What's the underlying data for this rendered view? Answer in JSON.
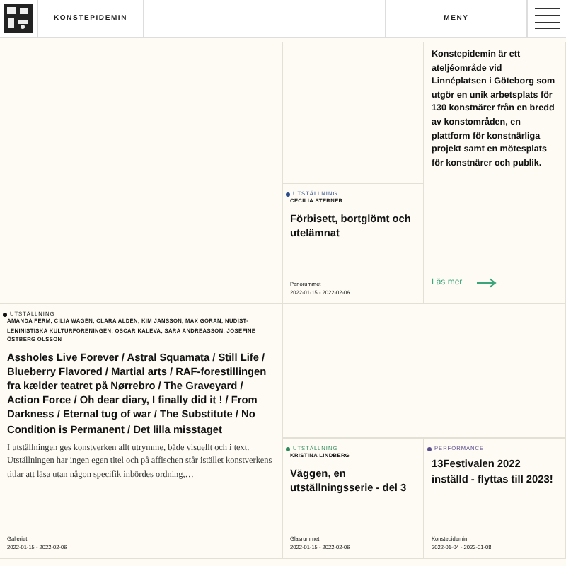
{
  "header": {
    "site_name": "KONSTEPIDEMIN",
    "menu_label": "MENY"
  },
  "intro": {
    "text": "Konstepidemin är ett ateljéområde vid Linnéplatsen i Göteborg som utgör en unik arbetsplats för 130 konstnärer från en bredd av konstområden, en plattform för konstnärliga projekt samt en mötesplats för konstnärer och publik.",
    "link": "Läs mer"
  },
  "events": [
    {
      "category": "UTSTÄLLNING",
      "color": "#2b4c8c",
      "artists": "CECILIA STERNER",
      "title": "Förbisett, bortglömt och utelämnat",
      "venue": "Panorummet",
      "dates": "2022-01-15 - 2022-02-06"
    },
    {
      "category": "UTSTÄLLNING",
      "color": "#111111",
      "artists": "AMANDA FERM, CILIA WAGÉN, CLARA ALDÉN, KIM JANSSON, MAX GÖRAN, NUDIST-LENINISTISKA KULTURFÖRENINGEN, OSCAR KALEVA, SARA ANDREASSON, JOSEFINE ÖSTBERG OLSSON",
      "title": "Assholes Live Forever / Astral Squamata / Still Life / Blueberry Flavored / Martial arts / RAF-forestillingen fra kælder teatret på Nørrebro / The Graveyard / Action Force / Oh dear diary, I finally did it ! / From Darkness / Eternal tug of war / The Substitute / No Condition is Permanent / Det lilla misstaget",
      "excerpt": "I utställningen ges konstverken allt utrymme, både visuellt och i text. Utställningen har ingen egen titel och på affischen står istället konstverkens titlar att läsa utan någon specifik inbördes ordning,…",
      "venue": "Galleriet",
      "dates": "2022-01-15 - 2022-02-06"
    },
    {
      "category": "UTSTÄLLNING",
      "color": "#2e8a5c",
      "artists": "KRISTINA LINDBERG",
      "title": "Väggen, en utställningsserie - del 3",
      "venue": "Glasrummet",
      "dates": "2022-01-15 - 2022-02-06"
    },
    {
      "category": "PERFORMANCE",
      "color": "#5a4d8c",
      "title": "13Festivalen 2022 inställd - flyttas till 2023!",
      "venue": "Konstepidemin",
      "dates": "2022-01-04 - 2022-01-08"
    }
  ]
}
